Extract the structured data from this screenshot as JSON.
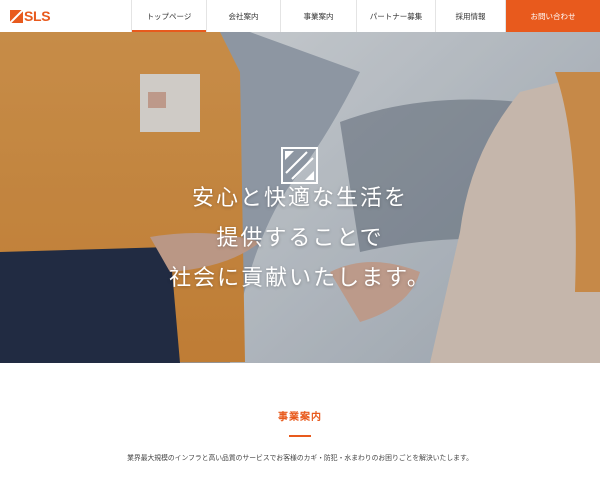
{
  "brand": {
    "logo_text": "SLS",
    "accent": "#e85a1d"
  },
  "nav": {
    "items": [
      {
        "label": "トップページ"
      },
      {
        "label": "会社案内"
      },
      {
        "label": "事業案内"
      },
      {
        "label": "パートナー募集"
      },
      {
        "label": "採用情報"
      }
    ],
    "active_index": 0,
    "contact_label": "お問い合わせ"
  },
  "hero": {
    "mark_icon": "sls-slash-logo-icon",
    "lines": [
      "安心と快適な生活を",
      "提供することで",
      "社会に貢献いたします。"
    ]
  },
  "section": {
    "title": "事業案内",
    "description": "業界最大規模のインフラと高い品質のサービスでお客様のカギ・防犯・水まわりのお困りごとを解決いたします。"
  }
}
